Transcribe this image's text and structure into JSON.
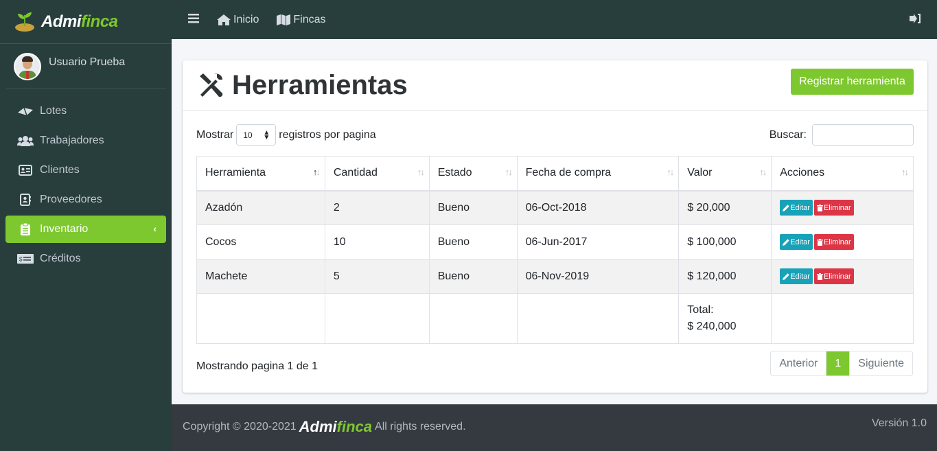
{
  "brand": {
    "name_a": "Admi",
    "name_b": "finca"
  },
  "user": {
    "name": "Usuario Prueba"
  },
  "sidebar": {
    "items": [
      {
        "label": "Lotes",
        "icon": "map-icon"
      },
      {
        "label": "Trabajadores",
        "icon": "users-icon"
      },
      {
        "label": "Clientes",
        "icon": "id-card-icon"
      },
      {
        "label": "Proveedores",
        "icon": "address-book-icon"
      },
      {
        "label": "Inventario",
        "icon": "clipboard-icon",
        "active": true
      },
      {
        "label": "Créditos",
        "icon": "money-bill-icon"
      }
    ]
  },
  "topnav": {
    "home_label": "Inicio",
    "farms_label": "Fincas"
  },
  "page": {
    "title": "Herramientas",
    "register_button": "Registrar herramienta",
    "show_label": "Mostrar",
    "show_value": "10",
    "per_page_label": "registros por pagina",
    "search_label": "Buscar:",
    "search_value": ""
  },
  "table": {
    "headers": [
      "Herramienta",
      "Cantidad",
      "Estado",
      "Fecha de compra",
      "Valor",
      "Acciones"
    ],
    "rows": [
      {
        "tool": "Azadón",
        "qty": "2",
        "state": "Bueno",
        "date": "06-Oct-2018",
        "value": "$ 20,000"
      },
      {
        "tool": "Cocos",
        "qty": "10",
        "state": "Bueno",
        "date": "06-Jun-2017",
        "value": "$ 100,000"
      },
      {
        "tool": "Machete",
        "qty": "5",
        "state": "Bueno",
        "date": "06-Nov-2019",
        "value": "$ 120,000"
      }
    ],
    "edit_label": "Editar",
    "delete_label": "Eliminar",
    "total_label": "Total:",
    "total_value": "$ 240,000"
  },
  "pagination": {
    "info": "Mostrando pagina 1 de 1",
    "prev": "Anterior",
    "current": "1",
    "next": "Siguiente"
  },
  "footer": {
    "copyright": "Copyright © 2020-2021",
    "rights": "All rights reserved.",
    "version": "Versión 1.0"
  },
  "colors": {
    "accent": "#7ec82f",
    "sidebar": "#283e3c",
    "edit": "#17a2b8",
    "delete": "#dc3545"
  }
}
